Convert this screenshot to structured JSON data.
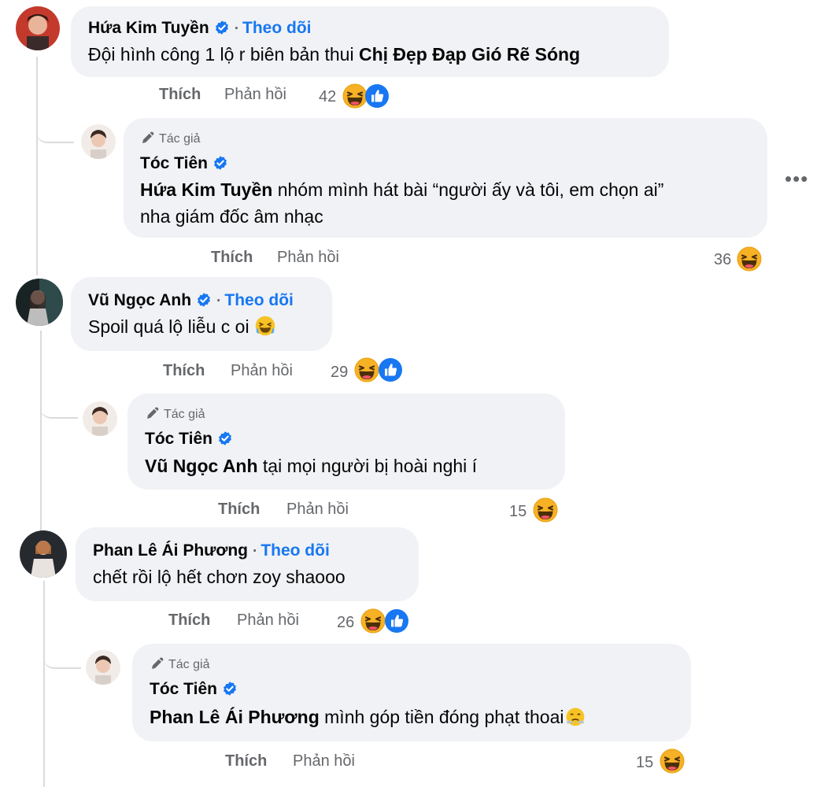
{
  "comments": [
    {
      "author": "Hứa Kim Tuyền",
      "follow": "Theo dõi",
      "text": "Đội hình công 1 lộ r biên bản thui ",
      "bold": "Chị Đẹp Đạp Gió Rẽ Sóng",
      "like": "Thích",
      "reply": "Phản hồi",
      "count": "42",
      "reactions": [
        "haha",
        "like"
      ]
    },
    {
      "tag": "Tác giả",
      "author": "Tóc Tiên",
      "mention": "Hứa Kim Tuyền",
      "text": " nhóm mình hát bài “người ấy và tôi, em chọn ai”",
      "text2": "nha giám đốc âm nhạc",
      "like": "Thích",
      "reply": "Phản hồi",
      "count": "36",
      "reactions": [
        "haha"
      ]
    },
    {
      "author": "Vũ Ngọc Anh",
      "follow": "Theo dõi",
      "text": "Spoil quá lộ liễu c oi ",
      "like": "Thích",
      "reply": "Phản hồi",
      "count": "29",
      "reactions": [
        "haha",
        "like"
      ]
    },
    {
      "tag": "Tác giả",
      "author": "Tóc Tiên",
      "mention": "Vũ Ngọc Anh",
      "text": " tại mọi người bị hoài nghi í",
      "like": "Thích",
      "reply": "Phản hồi",
      "count": "15",
      "reactions": [
        "haha"
      ]
    },
    {
      "author": "Phan Lê Ái Phương",
      "follow": "Theo dõi",
      "text": "chết rồi lộ hết chơn zoy shaooo",
      "like": "Thích",
      "reply": "Phản hồi",
      "count": "26",
      "reactions": [
        "haha",
        "like"
      ]
    },
    {
      "tag": "Tác giả",
      "author": "Tóc Tiên",
      "mention": "Phan Lê Ái Phương",
      "text": " mình góp tiền đóng phạt thoai",
      "like": "Thích",
      "reply": "Phản hồi",
      "count": "15",
      "reactions": [
        "haha"
      ]
    }
  ],
  "icons": {
    "verified": "verified-badge-icon",
    "pencil": "pencil-icon",
    "more": "more-options-icon"
  },
  "colors": {
    "link": "#1877f2",
    "bubble": "#f0f2f5",
    "secondary": "#65676b",
    "like": "#1877f2",
    "haha": "#f7b125"
  }
}
